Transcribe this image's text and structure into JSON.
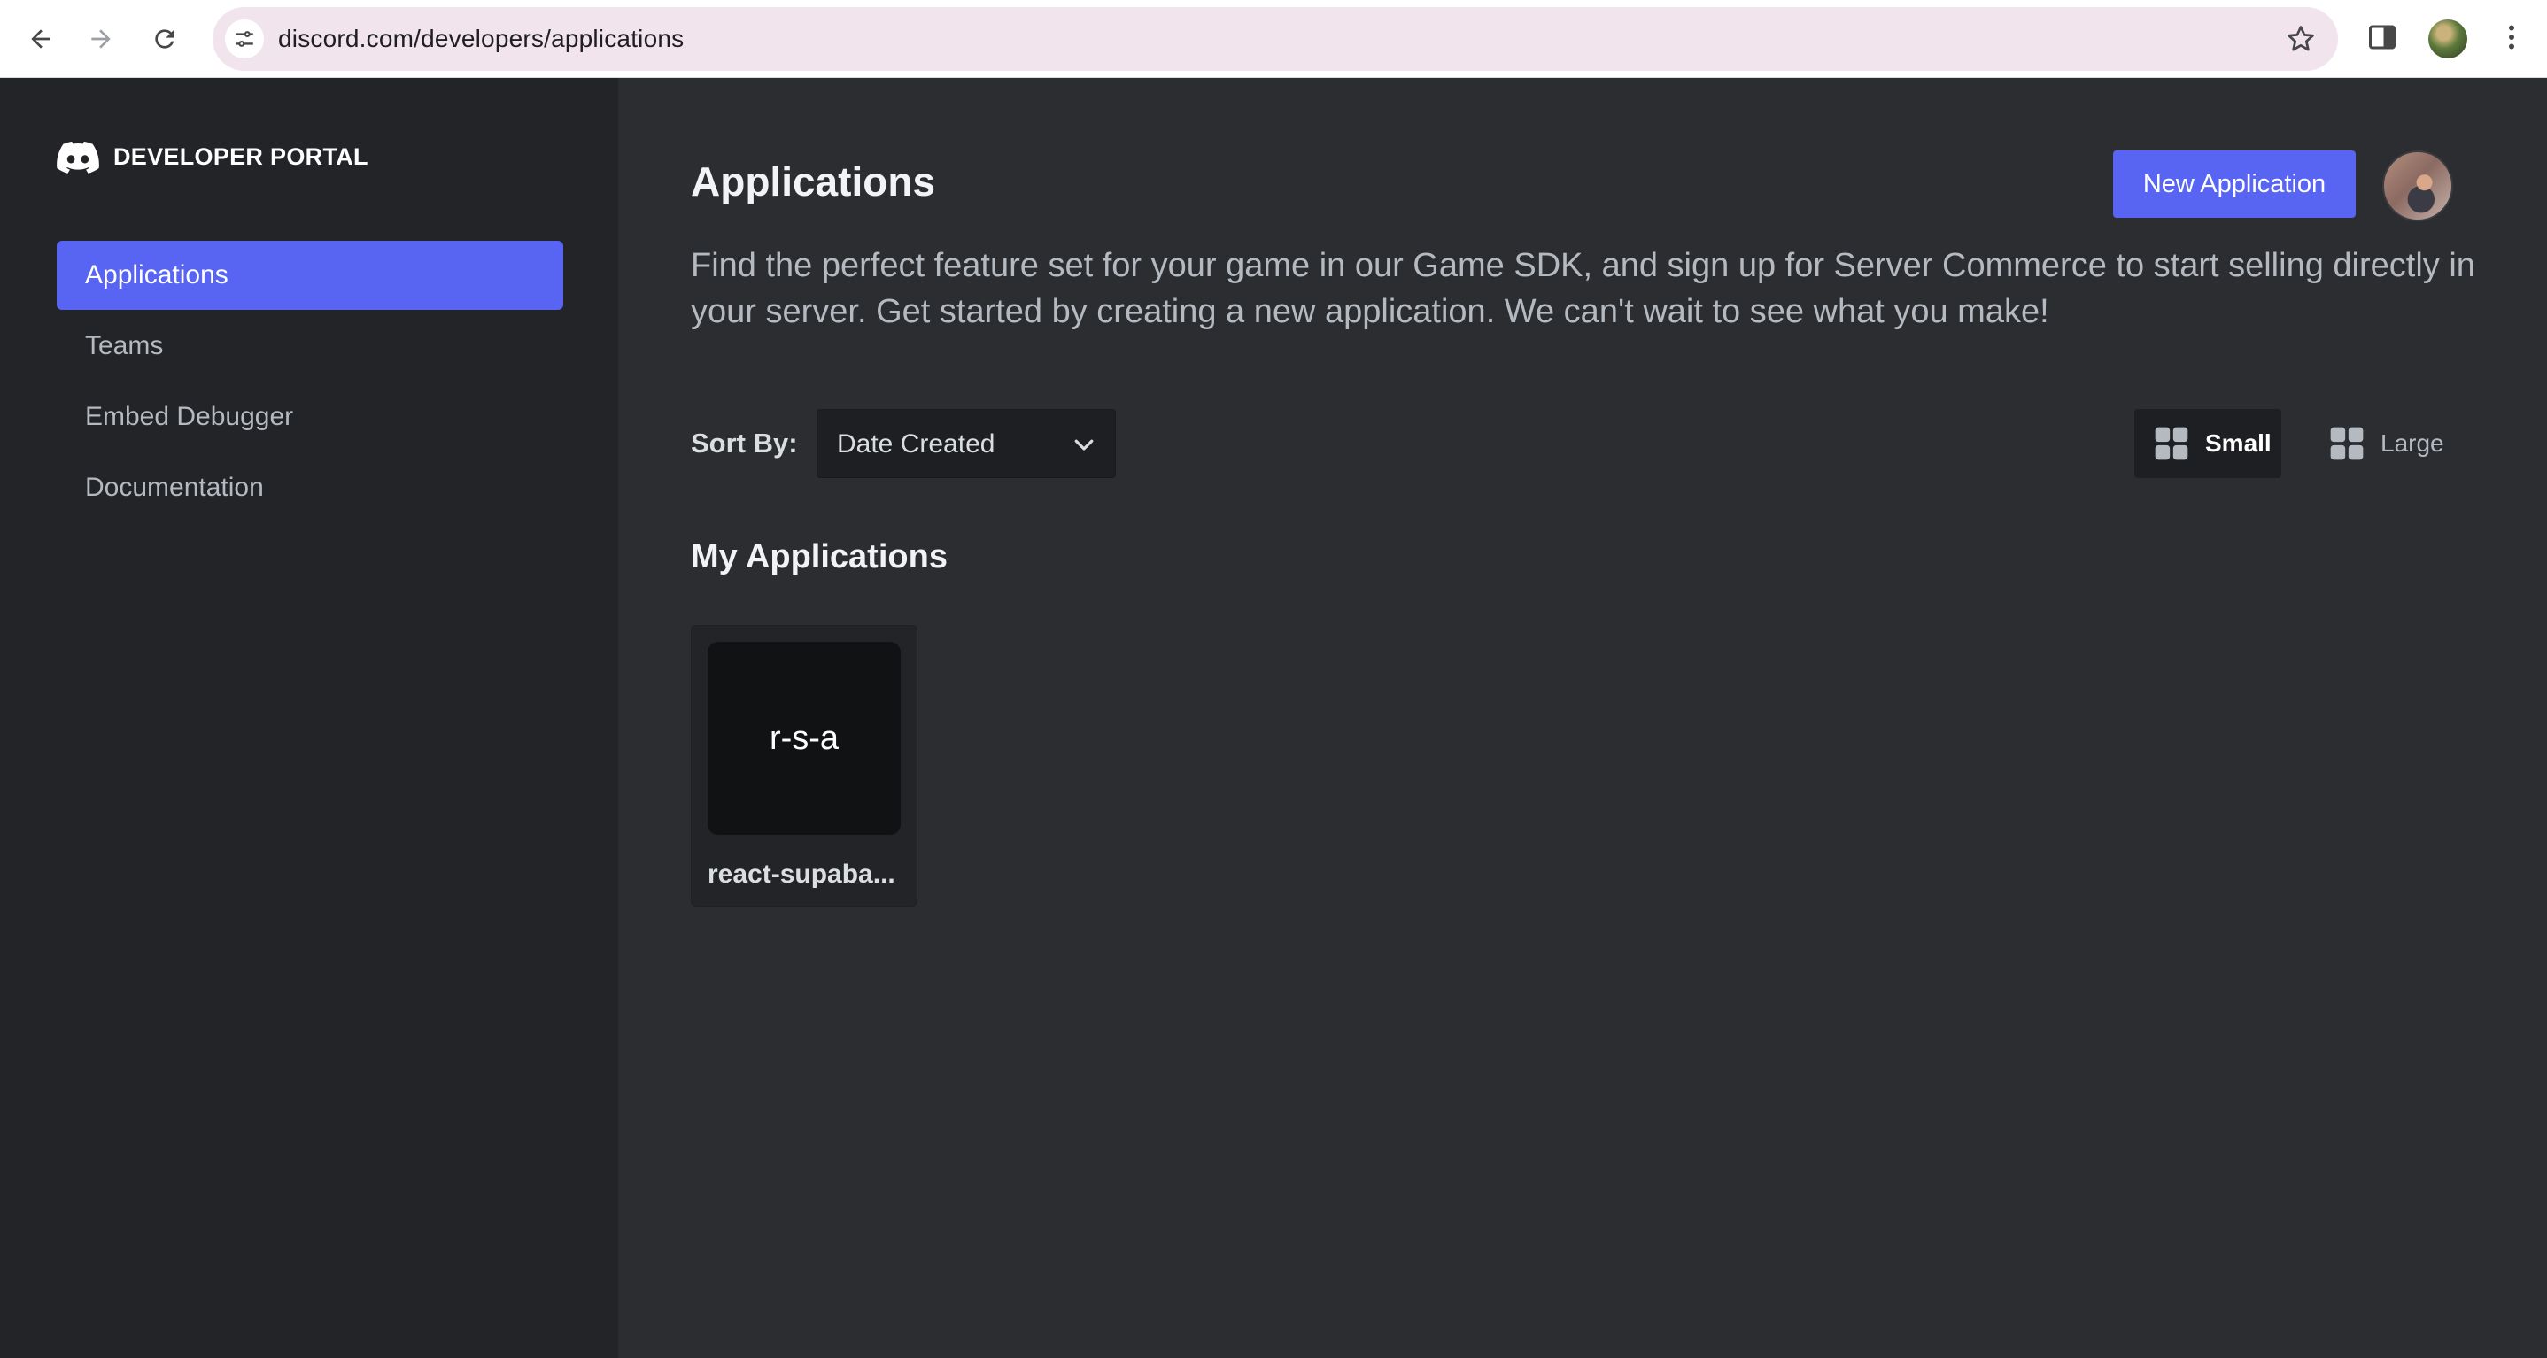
{
  "browser": {
    "url": "discord.com/developers/applications",
    "icons": [
      "back-arrow-icon",
      "forward-arrow-icon",
      "reload-icon",
      "site-info-icon",
      "star-icon",
      "side-panel-icon",
      "profile-avatar",
      "kebab-menu-icon"
    ]
  },
  "sidebar": {
    "brand": "DEVELOPER PORTAL",
    "items": [
      {
        "label": "Applications",
        "active": true
      },
      {
        "label": "Teams",
        "active": false
      },
      {
        "label": "Embed Debugger",
        "active": false
      },
      {
        "label": "Documentation",
        "active": false
      }
    ]
  },
  "main": {
    "title": "Applications",
    "new_app_label": "New Application",
    "intro": "Find the perfect feature set for your game in our Game SDK, and sign up for Server Commerce to start selling directly in your server. Get started by creating a new application. We can't wait to see what you make!",
    "sort_label": "Sort By:",
    "sort_value": "Date Created",
    "view_small": "Small",
    "view_large": "Large",
    "section_title": "My Applications",
    "apps": [
      {
        "initials": "r-s-a",
        "name": "react-supaba..."
      }
    ]
  },
  "colors": {
    "accent": "#5865f2",
    "background": "#2b2d31",
    "sidebar": "#232428"
  }
}
